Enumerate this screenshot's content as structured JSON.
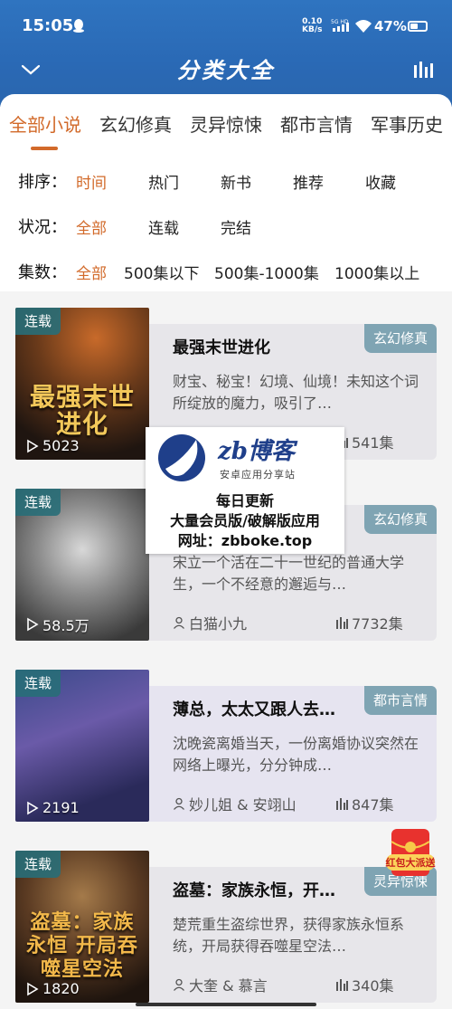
{
  "status_bar": {
    "time": "15:05",
    "net_speed_value": "0.10",
    "net_speed_unit": "KB/s",
    "network": "5G HD",
    "battery": "47%"
  },
  "header": {
    "title": "分类大全"
  },
  "tabs": [
    {
      "label": "全部小说",
      "active": true
    },
    {
      "label": "玄幻修真",
      "active": false
    },
    {
      "label": "灵异惊悚",
      "active": false
    },
    {
      "label": "都市言情",
      "active": false
    },
    {
      "label": "军事历史",
      "active": false
    }
  ],
  "filters": {
    "sort": {
      "label": "排序：",
      "options": [
        "时间",
        "热门",
        "新书",
        "推荐",
        "收藏"
      ],
      "selected": "时间"
    },
    "status": {
      "label": "状况：",
      "options": [
        "全部",
        "连载",
        "完结"
      ],
      "selected": "全部"
    },
    "episodes": {
      "label": "集数：",
      "options": [
        "全部",
        "500集以下",
        "500集-1000集",
        "1000集以上"
      ],
      "selected": "全部"
    }
  },
  "books": [
    {
      "status": "连载",
      "views": "5023",
      "cover_text": "最强末世进化",
      "category": "玄幻修真",
      "category_color": "#7fa4b3",
      "title": "最强末世进化",
      "desc": "财宝、秘宝！幻境、仙境！未知这个词所绽放的魔力，吸引了…",
      "author": "",
      "episodes": "541集"
    },
    {
      "status": "连载",
      "views": "58.5万",
      "cover_text": "",
      "category": "玄幻修真",
      "category_color": "#7fa4b3",
      "title": "",
      "desc": "宋立一个活在二十一世纪的普通大学生，一个不经意的邂逅与…",
      "author": "白猫小九",
      "episodes": "7732集"
    },
    {
      "status": "连载",
      "views": "2191",
      "cover_text": "",
      "category": "都市言情",
      "category_color": "#7fa4b3",
      "title": "薄总，太太又跟人去…",
      "desc": "沈晚瓷离婚当天，一份离婚协议突然在网络上曝光，分分钟成…",
      "author": "妙儿姐 & 安翊山",
      "episodes": "847集"
    },
    {
      "status": "连载",
      "views": "1820",
      "cover_text": "盗墓：家族永恒 开局吞噬星空法",
      "category": "灵异惊悚",
      "category_color": "#7fa4b3",
      "title": "盗墓：家族永恒，开…",
      "desc": "楚荒重生盗综世界，获得家族永恒系统，开局获得吞噬星空法…",
      "author": "大奎 & 慕言",
      "episodes": "340集"
    }
  ],
  "watermark": {
    "brand": "zb博客",
    "sub": "安卓应用分享站",
    "line1": "每日更新",
    "line2": "大量会员版/破解版应用",
    "line3": "网址：zbboke.top"
  },
  "promo": {
    "label": "红包大派送"
  },
  "colors": {
    "header_bg": "#2f74c0",
    "accent": "#d26a2a",
    "tag_bg": "#7fa4b3",
    "badge_bg": "#286e78"
  }
}
